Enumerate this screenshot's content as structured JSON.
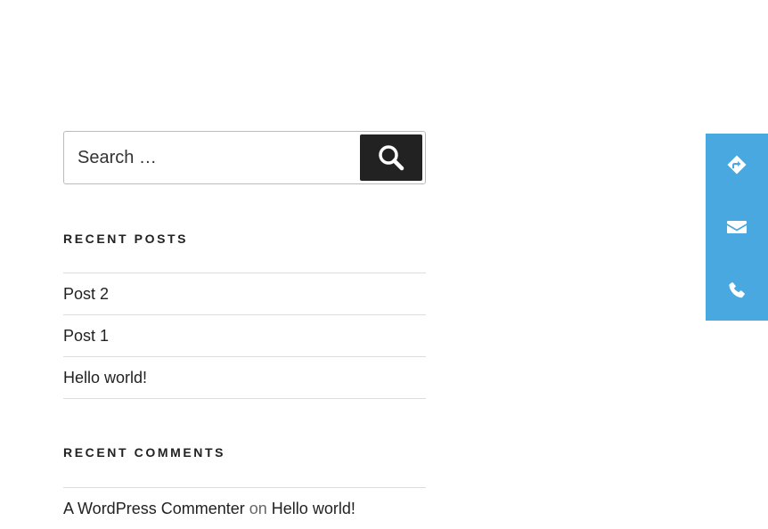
{
  "search": {
    "placeholder": "Search …",
    "button_label": "Search"
  },
  "recent_posts": {
    "title": "RECENT POSTS",
    "items": [
      {
        "label": "Post 2"
      },
      {
        "label": "Post 1"
      },
      {
        "label": "Hello world!"
      }
    ]
  },
  "recent_comments": {
    "title": "RECENT COMMENTS",
    "items": [
      {
        "author": "A WordPress Commenter",
        "connector": "on",
        "post": "Hello world!"
      }
    ]
  },
  "contact_bar": {
    "color": "#4aa8e0",
    "buttons": [
      {
        "icon": "directions-icon"
      },
      {
        "icon": "envelope-icon"
      },
      {
        "icon": "phone-icon"
      }
    ]
  }
}
